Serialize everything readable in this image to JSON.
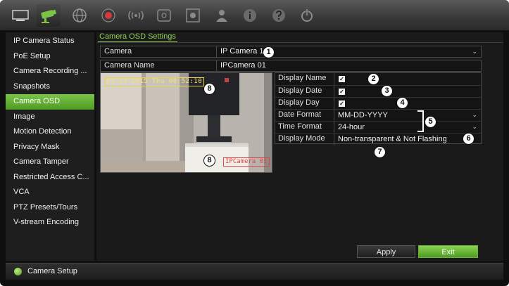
{
  "toolbar": {
    "icons": [
      "monitor-icon",
      "camera-icon",
      "network-icon",
      "record-icon",
      "alarm-icon",
      "hdd-icon",
      "device-icon",
      "user-icon",
      "info-icon",
      "help-icon",
      "power-icon"
    ]
  },
  "sidebar": {
    "items": [
      {
        "label": "IP Camera Status"
      },
      {
        "label": "PoE Setup"
      },
      {
        "label": "Camera Recording ..."
      },
      {
        "label": "Snapshots"
      },
      {
        "label": "Camera OSD",
        "active": true
      },
      {
        "label": "Image"
      },
      {
        "label": "Motion Detection"
      },
      {
        "label": "Privacy Mask"
      },
      {
        "label": "Camera Tamper"
      },
      {
        "label": "Restricted Access C..."
      },
      {
        "label": "VCA"
      },
      {
        "label": "PTZ Presets/Tours"
      },
      {
        "label": "V-stream Encoding"
      }
    ]
  },
  "main": {
    "title": "Camera OSD Settings",
    "camera": {
      "label": "Camera",
      "value": "IP Camera 1"
    },
    "camera_name": {
      "label": "Camera Name",
      "value": "IPCamera 01"
    },
    "preview": {
      "osd_date": "05-14-2015 Thu 06:52:10",
      "osd_name": "IPCamera 01"
    },
    "settings": {
      "display_name": {
        "label": "Display Name",
        "checked": true
      },
      "display_date": {
        "label": "Display Date",
        "checked": true
      },
      "display_day": {
        "label": "Display Day",
        "checked": true
      },
      "date_format": {
        "label": "Date Format",
        "value": "MM-DD-YYYY"
      },
      "time_format": {
        "label": "Time Format",
        "value": "24-hour"
      },
      "display_mode": {
        "label": "Display Mode",
        "value": "Non-transparent & Not Flashing"
      }
    },
    "markers": [
      "1",
      "2",
      "3",
      "4",
      "5",
      "6",
      "7",
      "8",
      "8"
    ],
    "apply_label": "Apply",
    "exit_label": "Exit"
  },
  "status": {
    "text": "Camera Setup"
  },
  "colors": {
    "accent": "#6cbb3c",
    "background": "#0f0f0f",
    "panel": "#1a1a1a",
    "osd_date": "#f6e07a",
    "osd_name": "#e04545"
  }
}
